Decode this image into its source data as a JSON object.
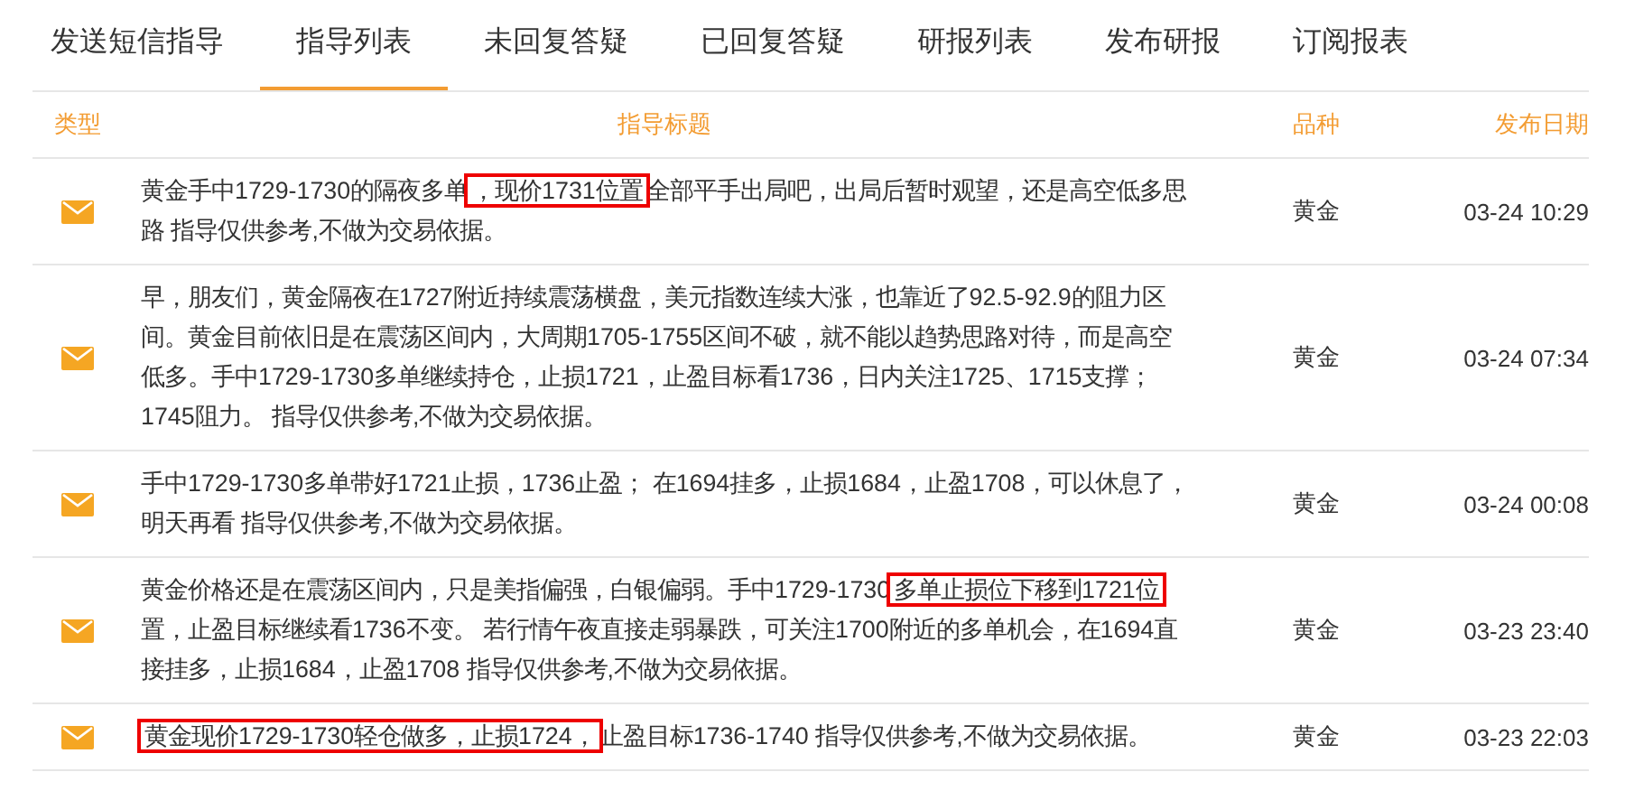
{
  "tabs": [
    {
      "label": "发送短信指导",
      "selected": false
    },
    {
      "label": "指导列表",
      "selected": true
    },
    {
      "label": "未回复答疑",
      "selected": false
    },
    {
      "label": "已回复答疑",
      "selected": false
    },
    {
      "label": "研报列表",
      "selected": false
    },
    {
      "label": "发布研报",
      "selected": false
    },
    {
      "label": "订阅报表",
      "selected": false
    }
  ],
  "table": {
    "columns": [
      "类型",
      "指导标题",
      "品种",
      "发布日期"
    ],
    "rows": [
      {
        "segments": [
          {
            "text": "黄金手中1729-1730的隔夜多单",
            "highlighted": false
          },
          {
            "text": "，现价1731位置",
            "highlighted": true
          },
          {
            "text": "全部平手出局吧，出局后暂时观望，还是高空低多思路 指导仅供参考,不做为交易依据。",
            "highlighted": false
          }
        ],
        "variety": "黄金",
        "date": "03-24 10:29"
      },
      {
        "segments": [
          {
            "text": "早，朋友们，黄金隔夜在1727附近持续震荡横盘，美元指数连续大涨，也靠近了92.5-92.9的阻力区间。黄金目前依旧是在震荡区间内，大周期1705-1755区间不破，就不能以趋势思路对待，而是高空低多。手中1729-1730多单继续持仓，止损1721，止盈目标看1736，日内关注1725、1715支撑；1745阻力。 指导仅供参考,不做为交易依据。",
            "highlighted": false
          }
        ],
        "variety": "黄金",
        "date": "03-24 07:34"
      },
      {
        "segments": [
          {
            "text": "手中1729-1730多单带好1721止损，1736止盈； 在1694挂多，止损1684，止盈1708，可以休息了，明天再看 指导仅供参考,不做为交易依据。",
            "highlighted": false
          }
        ],
        "variety": "黄金",
        "date": "03-24 00:08"
      },
      {
        "segments": [
          {
            "text": "黄金价格还是在震荡区间内，只是美指偏强，白银偏弱。手中1729-1730",
            "highlighted": false
          },
          {
            "text": "多单止损位下移到1721位",
            "highlighted": true
          },
          {
            "text": "置，止盈目标继续看1736不变。 若行情午夜直接走弱暴跌，可关注1700附近的多单机会，在1694直接挂多，止损1684，止盈1708 指导仅供参考,不做为交易依据。",
            "highlighted": false
          }
        ],
        "variety": "黄金",
        "date": "03-23 23:40"
      },
      {
        "segments": [
          {
            "text": "黄金现价1729-1730轻仓做多，止损1724，",
            "highlighted": true
          },
          {
            "text": "止盈目标1736-1740 指导仅供参考,不做为交易依据。",
            "highlighted": false
          }
        ],
        "variety": "黄金",
        "date": "03-23 22:03"
      }
    ]
  }
}
